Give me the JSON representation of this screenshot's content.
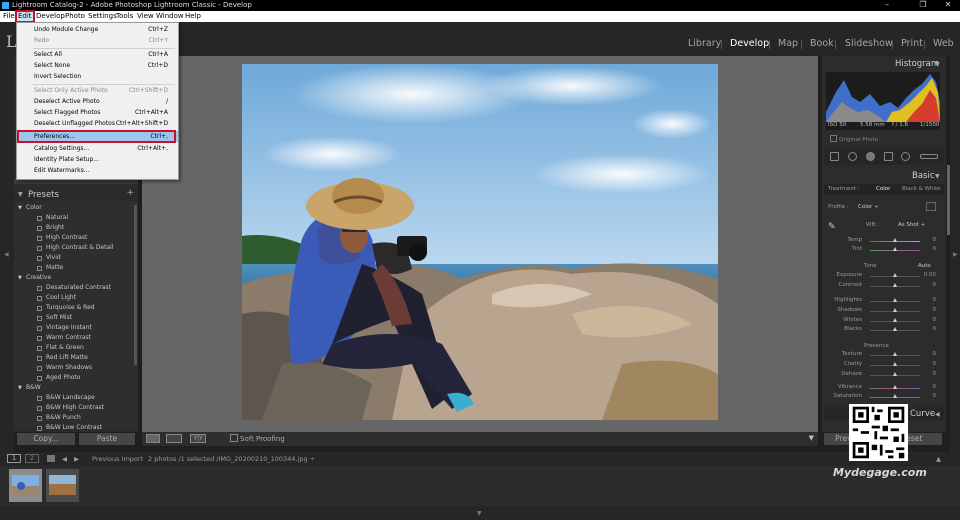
{
  "window": {
    "title": "Lightroom Catalog-2 - Adobe Photoshop Lightroom Classic - Develop",
    "min_glyph": "–",
    "max_glyph": "❐",
    "close_glyph": "✕"
  },
  "menubar": {
    "items": [
      "File",
      "Edit",
      "Develop",
      "Photo",
      "Settings",
      "Tools",
      "View",
      "Window",
      "Help"
    ]
  },
  "header": {
    "logo": "L",
    "modules": [
      "Library",
      "Develop",
      "Map",
      "Book",
      "Slideshow",
      "Print",
      "Web"
    ],
    "active_module": "Develop"
  },
  "edit_menu": {
    "items": [
      {
        "label": "Undo Module Change",
        "shortcut": "Ctrl+Z",
        "disabled": false
      },
      {
        "label": "Redo",
        "shortcut": "Ctrl+Y",
        "disabled": true
      },
      {
        "label": "Select All",
        "shortcut": "Ctrl+A",
        "disabled": false
      },
      {
        "label": "Select None",
        "shortcut": "Ctrl+D",
        "disabled": false
      },
      {
        "label": "Invert Selection",
        "shortcut": "",
        "disabled": false
      },
      {
        "label": "Select Only Active Photo",
        "shortcut": "Ctrl+Shift+D",
        "disabled": true
      },
      {
        "label": "Deselect Active Photo",
        "shortcut": "/",
        "disabled": false
      },
      {
        "label": "Select Flagged Photos",
        "shortcut": "Ctrl+Alt+A",
        "disabled": false
      },
      {
        "label": "Deselect Unflagged Photos",
        "shortcut": "Ctrl+Alt+Shift+D",
        "disabled": false
      },
      {
        "label": "Preferences...",
        "shortcut": "Ctrl+,",
        "disabled": false
      },
      {
        "label": "Catalog Settings...",
        "shortcut": "Ctrl+Alt+,",
        "disabled": false
      },
      {
        "label": "Identity Plate Setup...",
        "shortcut": "",
        "disabled": false
      },
      {
        "label": "Edit Watermarks...",
        "shortcut": "",
        "disabled": false
      }
    ]
  },
  "presets": {
    "title": "Presets",
    "add": "+",
    "groups": [
      {
        "name": "Color",
        "items": [
          "Natural",
          "Bright",
          "High Contrast",
          "High Contrast & Detail",
          "Vivid",
          "Matte"
        ]
      },
      {
        "name": "Creative",
        "items": [
          "Desaturated Contrast",
          "Cool Light",
          "Turquoise & Red",
          "Soft Mist",
          "Vintage Instant",
          "Warm Contrast",
          "Flat & Green",
          "Red Lift Matte",
          "Warm Shadows",
          "Aged Photo"
        ]
      },
      {
        "name": "B&W",
        "items": [
          "B&W Landscape",
          "B&W High Contrast",
          "B&W Punch",
          "B&W Low Contrast"
        ]
      }
    ]
  },
  "left_buttons": {
    "copy": "Copy...",
    "paste": "Paste"
  },
  "toolbar": {
    "soft_proofing": "Soft Proofing",
    "yy": "Y|Y"
  },
  "right": {
    "histogram": "Histogram",
    "hist_info": [
      "ISO 50",
      "5.58 mm",
      "f / 1.8",
      "1/1500"
    ],
    "original_photo": "Original Photo",
    "basic": "Basic",
    "treatment_label": "Treatment :",
    "treatment_color": "Color",
    "treatment_bw": "Black & White",
    "profile_label": "Profile :",
    "profile_value": "Color ÷",
    "wb_label": "WB :",
    "wb_value": "As Shot ÷",
    "tone_label": "Tone",
    "tone_auto": "Auto",
    "presence_label": "Presence",
    "tone_curve": "Curve",
    "sliders": [
      {
        "label": "Temp",
        "value": "0",
        "pos": 0.5
      },
      {
        "label": "Tint",
        "value": "0",
        "pos": 0.5
      },
      {
        "label": "Exposure",
        "value": "0.00",
        "pos": 0.5
      },
      {
        "label": "Contrast",
        "value": "0",
        "pos": 0.5
      },
      {
        "label": "Highlights",
        "value": "0",
        "pos": 0.5
      },
      {
        "label": "Shadows",
        "value": "0",
        "pos": 0.5
      },
      {
        "label": "Whites",
        "value": "0",
        "pos": 0.5
      },
      {
        "label": "Blacks",
        "value": "0",
        "pos": 0.5
      },
      {
        "label": "Texture",
        "value": "0",
        "pos": 0.5
      },
      {
        "label": "Clarity",
        "value": "0",
        "pos": 0.5
      },
      {
        "label": "Dehaze",
        "value": "0",
        "pos": 0.5
      },
      {
        "label": "Vibrance",
        "value": "0",
        "pos": 0.5
      },
      {
        "label": "Saturation",
        "value": "0",
        "pos": 0.5
      }
    ],
    "previous": "Previous",
    "reset": "Reset"
  },
  "filmstrip": {
    "pages": [
      "1",
      "2"
    ],
    "source": "Previous Import",
    "info": "2 photos /1 selected /IMG_20200210_100344.jpg ÷"
  },
  "watermark": "Mydegage.com"
}
